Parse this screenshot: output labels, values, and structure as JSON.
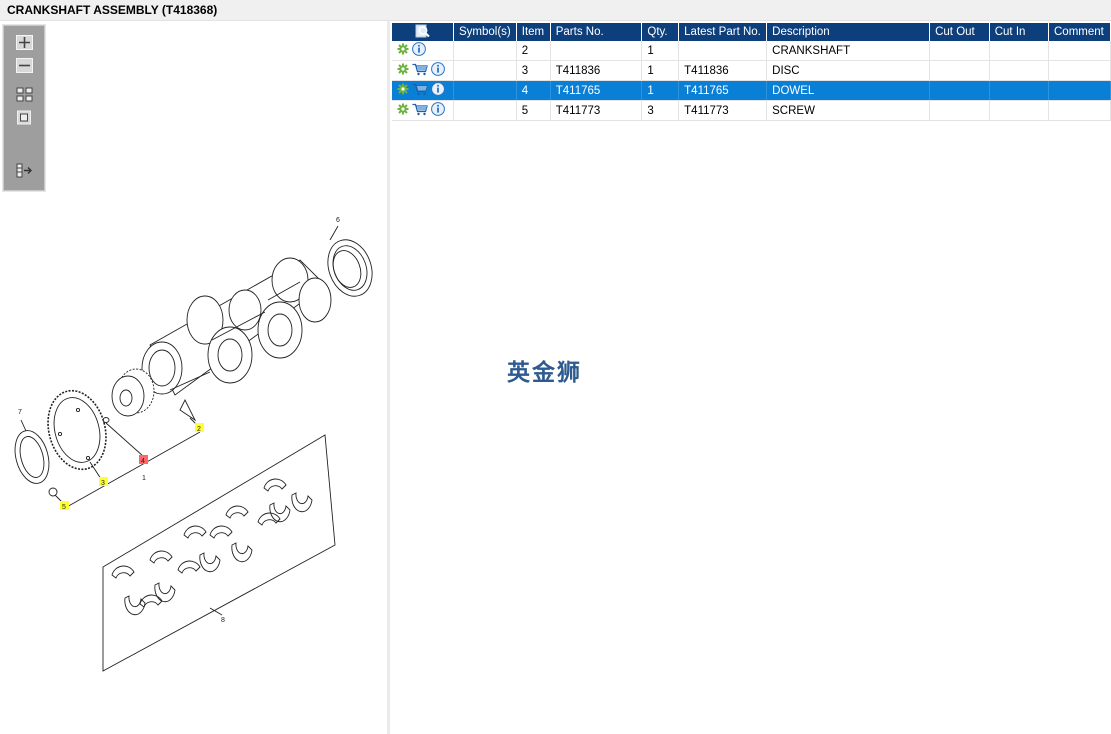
{
  "window": {
    "title": "CRANKSHAFT ASSEMBLY (T418368)"
  },
  "toolbar": {
    "items": [
      {
        "icon": "zoom-in-icon"
      },
      {
        "icon": "zoom-out-icon"
      },
      {
        "icon": "fit-all-icon"
      },
      {
        "icon": "actual-size-icon"
      },
      {
        "icon": "export-list-icon"
      }
    ]
  },
  "drawing": {
    "callouts": [
      "1",
      "2",
      "3",
      "4",
      "5",
      "6",
      "7",
      "8"
    ],
    "highlight_color": "#ffff33",
    "selected_color": "#ff6666"
  },
  "watermark": "英金狮",
  "parts_table": {
    "header_icon": "search-icon",
    "columns": [
      "Symbol(s)",
      "Item",
      "Parts No.",
      "Qty.",
      "Latest Part No.",
      "Description",
      "Cut Out",
      "Cut In",
      "Comment"
    ],
    "rows": [
      {
        "cart": false,
        "symbols": "",
        "item": "2",
        "parts_no": "",
        "qty": "1",
        "latest": "",
        "description": "CRANKSHAFT",
        "cut_out": "",
        "cut_in": "",
        "comment": "",
        "selected": false
      },
      {
        "cart": true,
        "symbols": "",
        "item": "3",
        "parts_no": "T411836",
        "qty": "1",
        "latest": "T411836",
        "description": "DISC",
        "cut_out": "",
        "cut_in": "",
        "comment": "",
        "selected": false
      },
      {
        "cart": true,
        "symbols": "",
        "item": "4",
        "parts_no": "T411765",
        "qty": "1",
        "latest": "T411765",
        "description": "DOWEL",
        "cut_out": "",
        "cut_in": "",
        "comment": "",
        "selected": true
      },
      {
        "cart": true,
        "symbols": "",
        "item": "5",
        "parts_no": "T411773",
        "qty": "3",
        "latest": "T411773",
        "description": "SCREW",
        "cut_out": "",
        "cut_in": "",
        "comment": "",
        "selected": false
      }
    ]
  },
  "colors": {
    "header_bg": "#0e3f7d",
    "selection": "#0a7fd6",
    "gear": "#6cb33f",
    "info": "#2a73c2"
  }
}
